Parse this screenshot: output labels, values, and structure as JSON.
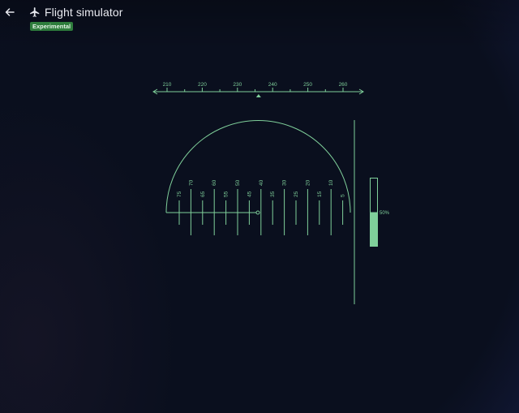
{
  "app": {
    "title": "Flight simulator",
    "badge": "Experimental"
  },
  "icons": {
    "back": "arrow-left-icon",
    "app": "airplane-icon"
  },
  "colors": {
    "instrument": "#7fcf9a",
    "badge_bg": "#2e7d3c",
    "title": "#e8eaf0"
  },
  "heading_tape": {
    "labels": [
      "210",
      "220",
      "230",
      "240",
      "250",
      "260"
    ],
    "min": 205,
    "max": 265,
    "current": 236
  },
  "speed_scale": {
    "labels": [
      "75",
      "70",
      "65",
      "60",
      "55",
      "50",
      "45",
      "40",
      "35",
      "30",
      "25",
      "20",
      "15",
      "10",
      "5"
    ]
  },
  "throttle": {
    "value": 0.5,
    "label": "50%"
  }
}
